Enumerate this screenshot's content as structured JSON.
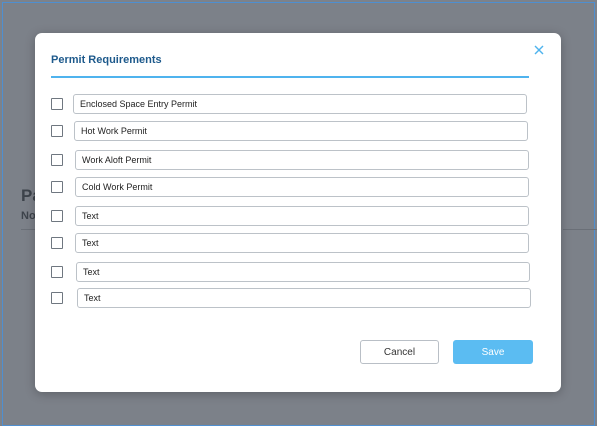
{
  "background": {
    "title_fragment": "Pa",
    "subtitle_fragment": "No"
  },
  "modal": {
    "title": "Permit Requirements",
    "close_icon": "close-icon",
    "accent_color": "#4fb3ee",
    "permits": [
      {
        "value": "Enclosed Space Entry Permit",
        "checked": false
      },
      {
        "value": "Hot Work Permit",
        "checked": false
      },
      {
        "value": "Work Aloft Permit",
        "checked": false
      },
      {
        "value": "Cold Work Permit",
        "checked": false
      },
      {
        "value": "Text",
        "checked": false
      },
      {
        "value": "Text",
        "checked": false
      },
      {
        "value": "Text",
        "checked": false
      },
      {
        "value": "Text",
        "checked": false
      }
    ],
    "cancel_label": "Cancel",
    "save_label": "Save",
    "save_color": "#5bbcf2"
  }
}
